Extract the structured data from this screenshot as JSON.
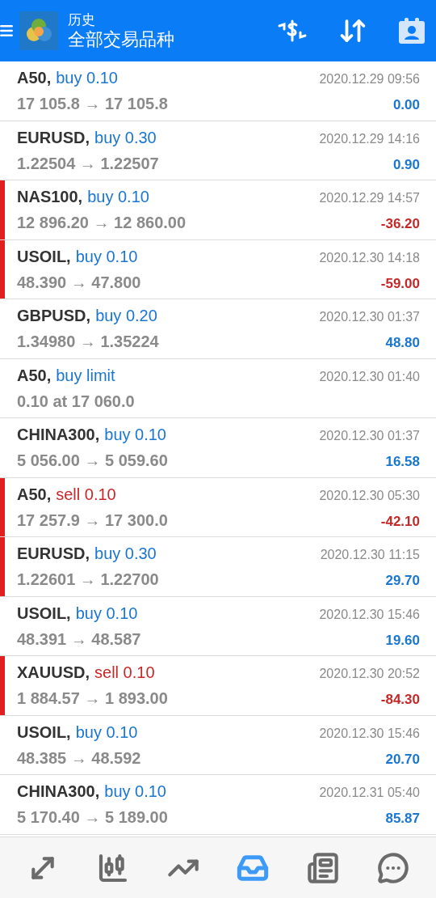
{
  "header": {
    "title": "历史",
    "subtitle": "全部交易品种"
  },
  "deals": [
    {
      "symbol": "A50,",
      "sell": false,
      "order": "buy 0.10",
      "prices": "17 105.8 → 17 105.8",
      "time": "2020.12.29 09:56",
      "profit": "0.00",
      "loss": false,
      "flagged": false
    },
    {
      "symbol": "EURUSD,",
      "sell": false,
      "order": "buy 0.30",
      "prices": "1.22504 → 1.22507",
      "time": "2020.12.29 14:16",
      "profit": "0.90",
      "loss": false,
      "flagged": false
    },
    {
      "symbol": "NAS100,",
      "sell": false,
      "order": "buy 0.10",
      "prices": "12 896.20 → 12 860.00",
      "time": "2020.12.29 14:57",
      "profit": "-36.20",
      "loss": true,
      "flagged": true
    },
    {
      "symbol": "USOIL,",
      "sell": false,
      "order": "buy 0.10",
      "prices": "48.390 → 47.800",
      "time": "2020.12.30 14:18",
      "profit": "-59.00",
      "loss": true,
      "flagged": true
    },
    {
      "symbol": "GBPUSD,",
      "sell": false,
      "order": "buy 0.20",
      "prices": "1.34980 → 1.35224",
      "time": "2020.12.30 01:37",
      "profit": "48.80",
      "loss": false,
      "flagged": false
    },
    {
      "symbol": "A50,",
      "sell": false,
      "order": "buy limit",
      "prices": "0.10 at 17 060.0",
      "time": "2020.12.30 01:40",
      "flagged": false
    },
    {
      "symbol": "CHINA300,",
      "sell": false,
      "order": "buy 0.10",
      "prices": "5 056.00 → 5 059.60",
      "time": "2020.12.30 01:37",
      "profit": "16.58",
      "loss": false,
      "flagged": false
    },
    {
      "symbol": "A50,",
      "sell": true,
      "order": "sell 0.10",
      "prices": "17 257.9 → 17 300.0",
      "time": "2020.12.30 05:30",
      "profit": "-42.10",
      "loss": true,
      "flagged": true
    },
    {
      "symbol": "EURUSD,",
      "sell": false,
      "order": "buy 0.30",
      "prices": "1.22601 → 1.22700",
      "time": "2020.12.30 11:15",
      "profit": "29.70",
      "loss": false,
      "flagged": true
    },
    {
      "symbol": "USOIL,",
      "sell": false,
      "order": "buy 0.10",
      "prices": "48.391 → 48.587",
      "time": "2020.12.30 15:46",
      "profit": "19.60",
      "loss": false,
      "flagged": false
    },
    {
      "symbol": "XAUUSD,",
      "sell": true,
      "order": "sell 0.10",
      "prices": "1 884.57 → 1 893.00",
      "time": "2020.12.30 20:52",
      "profit": "-84.30",
      "loss": true,
      "flagged": true
    },
    {
      "symbol": "USOIL,",
      "sell": false,
      "order": "buy 0.10",
      "prices": "48.385 → 48.592",
      "time": "2020.12.30 15:46",
      "profit": "20.70",
      "loss": false,
      "flagged": false
    },
    {
      "symbol": "CHINA300,",
      "sell": false,
      "order": "buy 0.10",
      "prices": "5 170.40 → 5 189.00",
      "time": "2020.12.31 05:40",
      "profit": "85.87",
      "loss": false,
      "flagged": false
    }
  ],
  "nav": [
    {
      "kind": "trade",
      "selected": false
    },
    {
      "kind": "candles",
      "selected": false
    },
    {
      "kind": "chart",
      "selected": false
    },
    {
      "kind": "history",
      "selected": true
    },
    {
      "kind": "news",
      "selected": false
    },
    {
      "kind": "chat",
      "selected": false
    }
  ]
}
